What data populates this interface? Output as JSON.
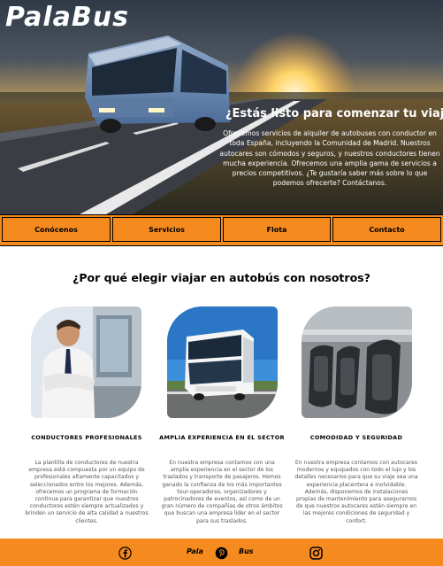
{
  "brand": {
    "logo": "PalaBus"
  },
  "hero": {
    "title": "¿Estás listo para comenzar tu viaje?",
    "text": "Ofrecemos servicios de alquiler de autobuses con conductor en toda España, incluyendo la Comunidad de Madrid. Nuestros autocares son cómodos y seguros, y nuestros conductores tienen mucha experiencia. Ofrecemos una amplia gama de servicios a precios competitivos. ¿Te gustaría saber más sobre lo que podemos ofrecerte? Contáctanos."
  },
  "nav": {
    "items": [
      {
        "label": "Conócenos"
      },
      {
        "label": "Servicios"
      },
      {
        "label": "Flota"
      },
      {
        "label": "Contacto"
      }
    ]
  },
  "section": {
    "title": "¿Por qué elegir viajar en autobús con nosotros?",
    "features": [
      {
        "title": "CONDUCTORES PROFESIONALES",
        "text": "La plantilla de conductores de nuestra empresa está compuesta por un equipo de profesionales altamente capacitados y seleccionados entre los mejores. Además, ofrecemos un programa de formación continua para garantizar que nuestros conductores estén siempre actualizados y brinden un servicio de alta calidad a nuestros clientes."
      },
      {
        "title": "AMPLIA EXPERIENCIA EN EL SECTOR",
        "text": "En nuestra empresa contamos con una amplia experiencia en el sector de los traslados y transporte de pasajeros. Hemos ganado la confianza de los más importantes tour-operadores, organizadores y patrocinadores de eventos, así como de un gran número de compañías de otros ámbitos que buscan una empresa líder en el sector para sus traslados."
      },
      {
        "title": "COMODIDAD Y SEGURIDAD",
        "text": "En nuestra empresa contamos con autocares modernos y equipados con todo el lujo y los detalles necesarios para que su viaje sea una experiencia placentera e inolvidable. Además, disponemos de instalaciones propias de mantenimiento para asegurarnos de que nuestros autocares estén siempre en las mejores condiciones de seguridad y confort."
      }
    ]
  },
  "footer": {
    "brand_left": "Pala",
    "brand_right": "Bus",
    "icons": [
      "facebook-icon",
      "pinterest-icon",
      "instagram-icon"
    ]
  },
  "colors": {
    "accent": "#f58a1f",
    "text": "#000000",
    "muted": "#555555"
  }
}
